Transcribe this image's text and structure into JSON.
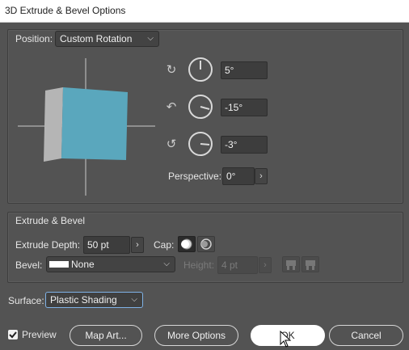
{
  "window": {
    "title": "3D Extrude & Bevel Options"
  },
  "position": {
    "label": "Position:",
    "value": "Custom Rotation",
    "x_angle": "5°",
    "y_angle": "-15°",
    "z_angle": "-3°",
    "perspective_label": "Perspective:",
    "perspective_value": "0°"
  },
  "extrude": {
    "section_title": "Extrude & Bevel",
    "depth_label": "Extrude Depth:",
    "depth_value": "50 pt",
    "cap_label": "Cap:",
    "bevel_label": "Bevel:",
    "bevel_value": "None",
    "height_label": "Height:",
    "height_value": "4 pt"
  },
  "surface": {
    "label": "Surface:",
    "value": "Plastic Shading"
  },
  "footer": {
    "preview_label": "Preview",
    "preview_checked": true,
    "map_art_label": "Map Art...",
    "more_options_label": "More Options",
    "ok_label": "OK",
    "cancel_label": "Cancel"
  },
  "colors": {
    "cube_front": "#5aa7bd",
    "cube_side": "#b5b5b5",
    "background": "#535353"
  },
  "icons": {
    "x_axis": "rotate-x-axis-icon",
    "y_axis": "rotate-y-axis-icon",
    "z_axis": "rotate-z-axis-icon",
    "cap_on": "cap-on-icon",
    "cap_off": "cap-off-icon",
    "bevel_out": "bevel-out-icon",
    "bevel_in": "bevel-in-icon"
  }
}
